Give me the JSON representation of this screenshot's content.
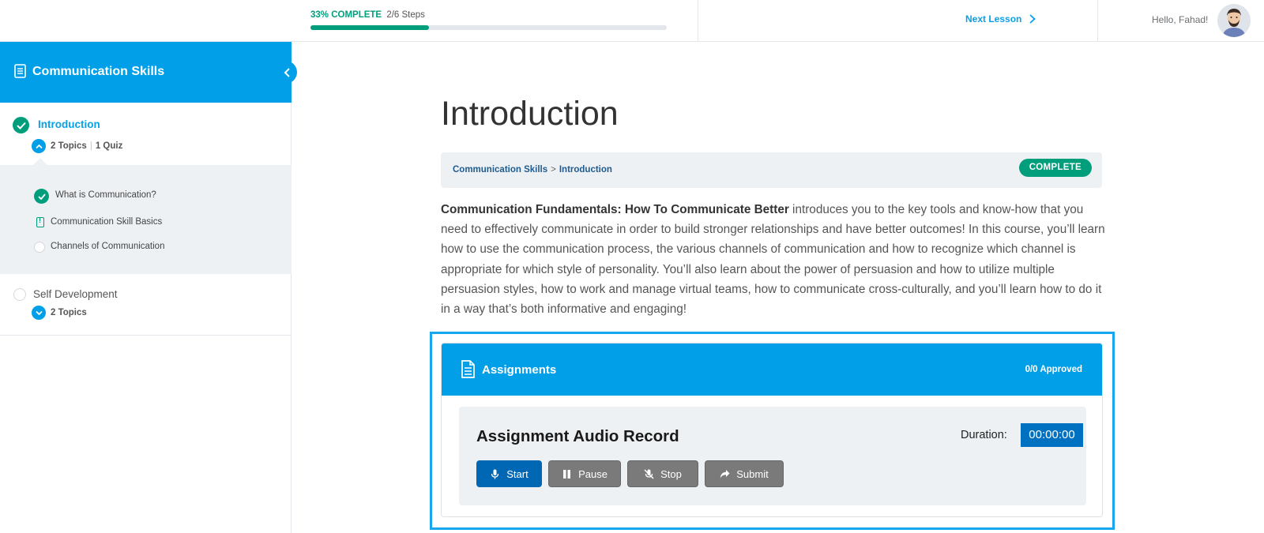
{
  "topbar": {
    "progress_percent_label": "33% COMPLETE",
    "progress_steps": "2/6 Steps",
    "progress_fraction": 0.333,
    "next_lesson_label": "Next Lesson",
    "greeting": "Hello, Fahad!"
  },
  "sidebar": {
    "course_title": "Communication Skills",
    "lessons": [
      {
        "title": "Introduction",
        "status": "complete",
        "meta_topics": "2 Topics",
        "meta_quiz": "1 Quiz",
        "topics": [
          {
            "label": "What is Communication?",
            "status": "complete"
          },
          {
            "label": "Communication Skill Basics",
            "status": "quiz"
          },
          {
            "label": "Channels of Communication",
            "status": "incomplete"
          }
        ]
      },
      {
        "title": "Self Development",
        "status": "incomplete",
        "meta_topics": "2 Topics"
      }
    ]
  },
  "main": {
    "title": "Introduction",
    "breadcrumb": {
      "course": "Communication Skills",
      "separator": ">",
      "lesson": "Introduction"
    },
    "status_badge": "COMPLETE",
    "description_lead": "Communication Fundamentals: How To Communicate Better",
    "description_body": " introduces you to the key tools and know-how that you need to effectively communicate in order to build stronger relationships and have better outcomes! In this course, you’ll learn how to use the communication process, the various channels of communication and how to recognize which channel is appropriate for which style of personality. You’ll also learn about the power of persuasion and how to utilize multiple persuasion styles, how to work and manage virtual teams, how to communicate cross-culturally, and you’ll learn how to do it in a way that’s both informative and engaging!",
    "assignments": {
      "title": "Assignments",
      "approved": "0/0 Approved",
      "record": {
        "title": "Assignment Audio Record",
        "duration_label": "Duration:",
        "duration_value": "00:00:00",
        "buttons": {
          "start": "Start",
          "pause": "Pause",
          "stop": "Stop",
          "submit": "Submit"
        }
      }
    }
  },
  "colors": {
    "brand_blue": "#019fe8",
    "success_green": "#019e7c",
    "link_blue": "#0aa0e6",
    "record_blue": "#0071c1",
    "button_gray": "#7a7a7a",
    "focus_outline": "#18a6ee"
  },
  "icons": {
    "course": "document-icon",
    "collapse": "chevron-left-icon",
    "next": "chevron-right-icon",
    "lesson_complete": "check-circle-icon",
    "expand": "chevron-circle-icon",
    "quiz": "quiz-icon",
    "start": "microphone-icon",
    "pause": "pause-icon",
    "stop": "mic-off-icon",
    "submit": "share-arrow-icon"
  }
}
